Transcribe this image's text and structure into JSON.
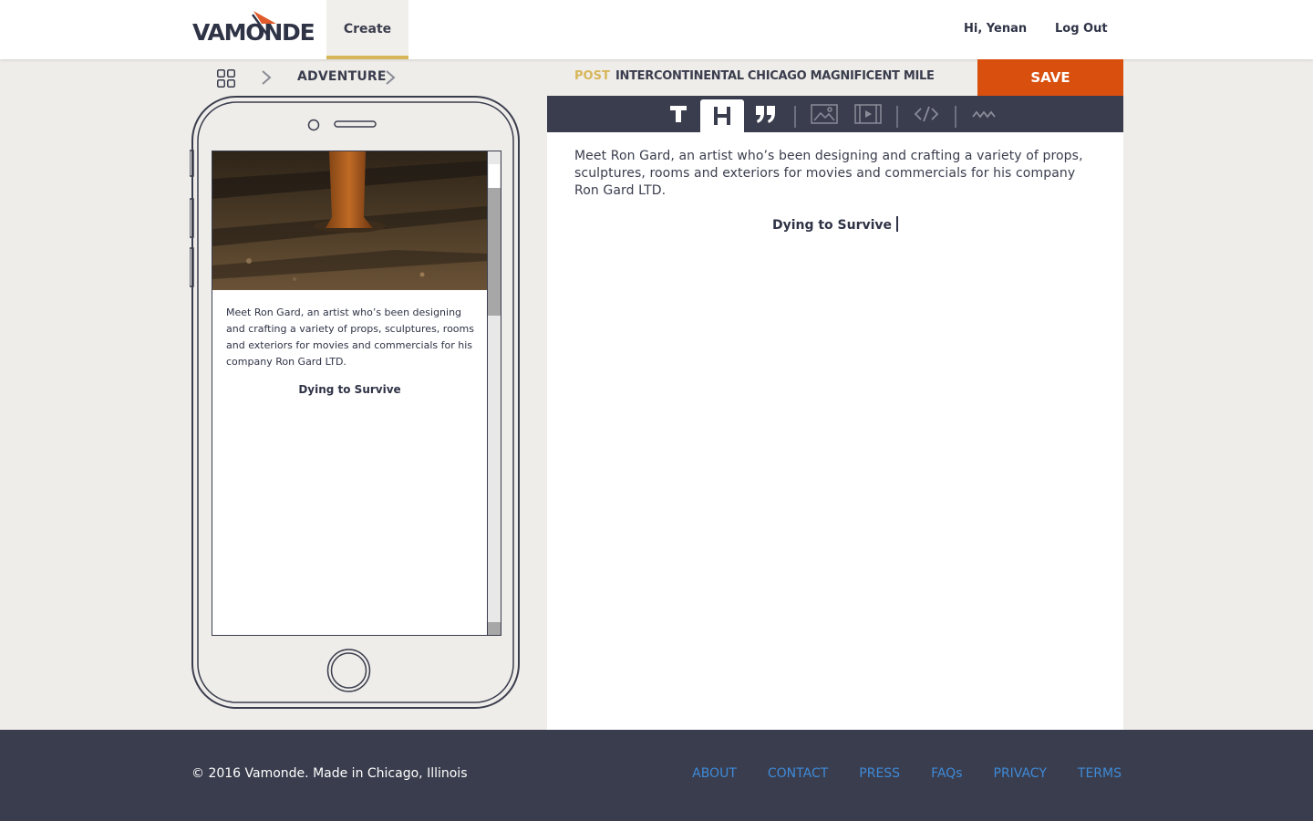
{
  "header": {
    "logo_text": "VAMONDE",
    "nav_create": "Create",
    "greeting": "Hi, Yenan",
    "logout": "Log Out"
  },
  "breadcrumb": {
    "category": "ADVENTURE",
    "post_label": "POST",
    "post_title": "INTERCONTINENTAL CHICAGO MAGNIFICENT MILE",
    "save_label": "SAVE"
  },
  "toolbar": {
    "tools": [
      "text-icon",
      "heading-icon",
      "quote-icon",
      "image-icon",
      "video-icon",
      "embed-code-icon",
      "divider-icon"
    ],
    "active_tool": "heading-icon"
  },
  "content": {
    "paragraph": "Meet Ron Gard, an artist who’s been designing and crafting a variety of props, sculptures, rooms and exteriors for movies and commercials for his company Ron Gard LTD.",
    "heading": "Dying to Survive"
  },
  "footer": {
    "copyright": "© 2016 Vamonde. Made in Chicago, Illinois",
    "links": [
      "ABOUT",
      "CONTACT",
      "PRESS",
      "FAQs",
      "PRIVACY",
      "TERMS"
    ]
  },
  "colors": {
    "accent_orange": "#d94f0e",
    "accent_gold": "#d7b659",
    "navy": "#3a3d4d",
    "link_blue": "#3e8ad8",
    "page_bg": "#efedea"
  }
}
